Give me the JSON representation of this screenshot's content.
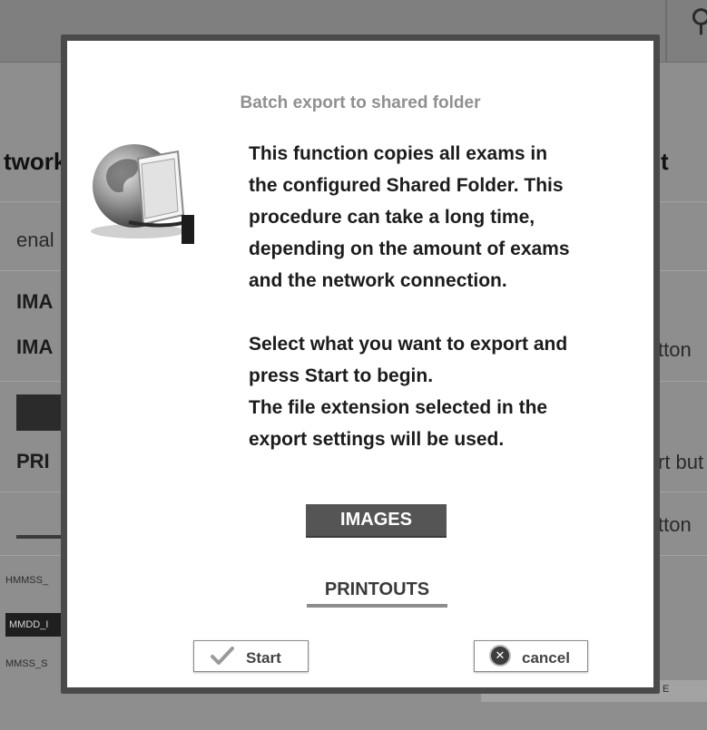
{
  "background": {
    "top_icon": "network-icon",
    "col_header_left": "twork",
    "col_header_right": "t",
    "row_enable": "enal",
    "row_ima_1": "IMA",
    "row_ima_2": "IMA",
    "row_ima_right": "tton",
    "row_pri": "PRI",
    "row_pri_right": "rt but",
    "row_pri2_right": "tton",
    "small_1": "HMMSS_",
    "small_2": "MMDD_I",
    "small_3": "MMSS_S",
    "small_right": "E"
  },
  "modal": {
    "title": "Batch export to shared folder",
    "icon": "globe-folder-export-icon",
    "body_lines_1": [
      "This function copies all exams in",
      "the configured Shared Folder. This",
      "procedure can take a long time,",
      "depending on the amount of exams",
      "and the network connection."
    ],
    "body_lines_2": [
      "Select what you want to export and",
      "press Start to begin.",
      "The file extension selected in the",
      "export settings will be used."
    ],
    "images_label": "IMAGES",
    "printouts_label": "PRINTOUTS",
    "start_label": "Start",
    "start_icon": "checkmark-icon",
    "cancel_label": "cancel",
    "cancel_icon": "close-circle-icon"
  }
}
